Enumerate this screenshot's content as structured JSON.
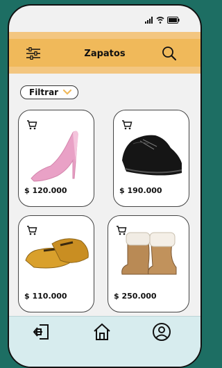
{
  "header": {
    "title": "Zapatos",
    "menu_icon": "sliders-icon",
    "search_icon": "search-icon"
  },
  "status": {
    "icons": [
      "signal-icon",
      "wifi-icon",
      "battery-icon"
    ]
  },
  "filter": {
    "label": "Filtrar",
    "icon": "chevron-down-icon"
  },
  "products": [
    {
      "name": "pink-heel",
      "price": "$ 120.000"
    },
    {
      "name": "black-oxford",
      "price": "$ 190.000"
    },
    {
      "name": "mustard-loafer",
      "price": "$ 110.000"
    },
    {
      "name": "fur-boot",
      "price": "$ 250.000"
    }
  ],
  "nav": {
    "items": [
      "logout-icon",
      "home-icon",
      "profile-icon"
    ]
  },
  "colors": {
    "background": "#1d6e63",
    "header": "#f0b95a",
    "bottom_nav": "#d7ecee",
    "accent": "#f0b95a"
  }
}
